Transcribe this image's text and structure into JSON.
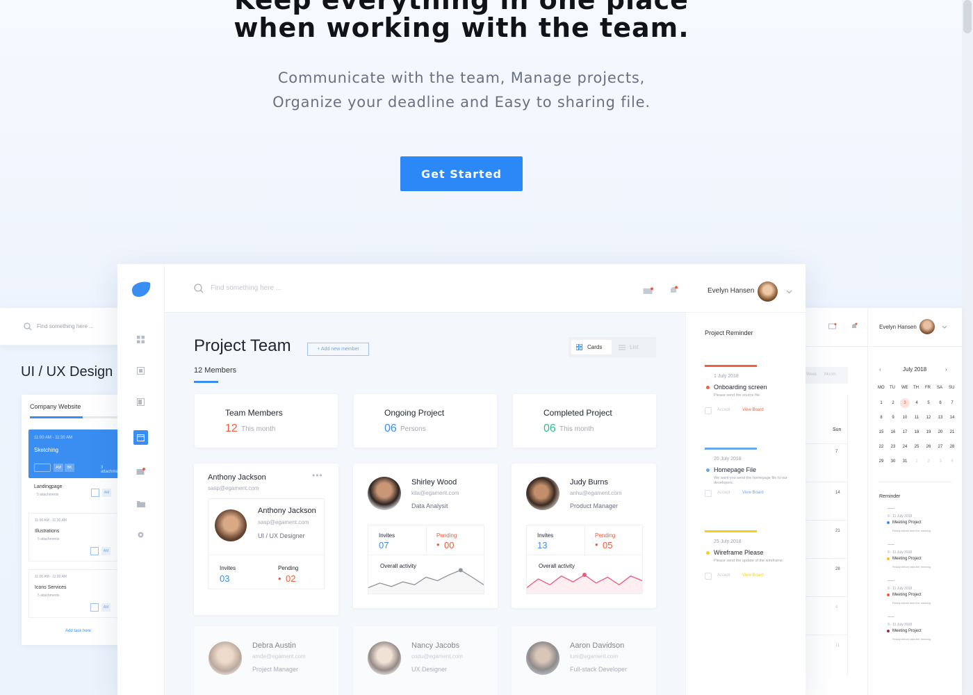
{
  "hero": {
    "title_partial": "Keep everything in one place",
    "title": "when working with the team.",
    "subtitle_line1": "Communicate with the team, Manage projects,",
    "subtitle_line2": "Organize your deadline and Easy to sharing file.",
    "cta": "Get Started"
  },
  "left_panel": {
    "search_placeholder": "Find something here ...",
    "heading": "UI / UX Design P",
    "project": "Company Website",
    "progress": 0.6,
    "tasks": [
      {
        "time": "11:00 AM - 11:30 AM",
        "title": "Sketching",
        "attachments": "3 attachments"
      },
      {
        "time": "",
        "title": "Landingpage",
        "attachments": "5 attachments"
      },
      {
        "time": "11:00 AM - 11:30 AM",
        "title": "Illustrations",
        "attachments": "5 attachments"
      },
      {
        "time": "11:00 AM - 11:30 AM",
        "title": "Icons Services",
        "attachments": "5 attachments"
      }
    ],
    "tag_am": "AM",
    "tag_bk": "BK",
    "add_task": "Add task here"
  },
  "right_panel": {
    "user": "Evelyn Hansen",
    "tabs": [
      "Week",
      "Month"
    ],
    "day_header": "Sun",
    "week_numbers": [
      "7",
      "14",
      "21",
      "28",
      "4",
      "11"
    ],
    "month": "July 2018",
    "weekdays": [
      "MO",
      "TU",
      "WE",
      "TH",
      "FR",
      "SA",
      "SU"
    ],
    "days": [
      "1",
      "2",
      "3",
      "4",
      "5",
      "6",
      "7",
      "8",
      "9",
      "10",
      "11",
      "12",
      "13",
      "14",
      "15",
      "16",
      "17",
      "18",
      "19",
      "20",
      "21",
      "22",
      "23",
      "24",
      "25",
      "26",
      "27",
      "28",
      "29",
      "30",
      "31",
      "1",
      "2",
      "3",
      "4"
    ],
    "reminder_title": "Reminder",
    "reminders": [
      {
        "date": "9 - 11 July 2018",
        "title": "Meeting Project",
        "note": "Ready before start the meeting",
        "color": "#3a8ef1"
      },
      {
        "date": "9 - 11 July 2018",
        "title": "Meeting Project",
        "note": "Ready before start the meeting",
        "color": "#f5c518"
      },
      {
        "date": "9 - 11 July 2018",
        "title": "Meeting Project",
        "note": "Ready before start the meeting",
        "color": "#f15a3a"
      },
      {
        "date": "9 - 11 July 2018",
        "title": "Meeting Project",
        "note": "Ready before start the meeting",
        "color": "#9b2f4a"
      }
    ]
  },
  "app": {
    "search_placeholder": "Find something here ...",
    "user": "Evelyn Hansen",
    "page_title": "Project Team",
    "add_member": "+ Add new member",
    "members_count": "12 Members",
    "view_cards": "Cards",
    "view_list": "List",
    "stats": [
      {
        "title": "Team Members",
        "value": "12",
        "note": "This month",
        "color": "#f15a3a"
      },
      {
        "title": "Ongoing Project",
        "value": "06",
        "note": "Persons",
        "color": "#3a8ef1"
      },
      {
        "title": "Completed Project",
        "value": "06",
        "note": "This month",
        "color": "#2fbd8e"
      }
    ],
    "featured": {
      "header_name": "Anthony Jackson",
      "header_email": "sasp@egament.com",
      "name": "Anthony Jackson",
      "email": "sasp@egament.com",
      "role": "UI / UX Designer",
      "invites_label": "Invites",
      "invites": "03",
      "pending_label": "Pending",
      "pending": "02"
    },
    "members": [
      {
        "name": "Shirley Wood",
        "email": "kila@egament.com",
        "role": "Data Analysit",
        "invites": "07",
        "pending": "00",
        "activity_label": "Overall activity",
        "activity": [
          40,
          48,
          42,
          50,
          45,
          58,
          52,
          62,
          70,
          58,
          45
        ]
      },
      {
        "name": "Judy Burns",
        "email": "anhu@egament.com",
        "role": "Product Manager",
        "invites": "13",
        "pending": "05",
        "activity_label": "Overall activity",
        "activity": [
          40,
          55,
          45,
          60,
          50,
          62,
          48,
          58,
          45,
          60,
          52
        ]
      }
    ],
    "invites_label": "Invites",
    "pending_label": "Pending",
    "faded_members": [
      {
        "name": "Debra Austin",
        "email": "amde@egament.com",
        "role": "Project Manager"
      },
      {
        "name": "Nancy Jacobs",
        "email": "codu@egament.com",
        "role": "UX Designer"
      },
      {
        "name": "Aaron Davidson",
        "email": "luni@egament.com",
        "role": "Full-stack Developer"
      }
    ],
    "reminder_title": "Project Reminder",
    "reminders": [
      {
        "date": "1 July 2018",
        "title": "Onboarding screen",
        "note": "Please send the source file.",
        "accept": "Accept",
        "view": "View Board",
        "color": "#f0603f"
      },
      {
        "date": "20 July 2018",
        "title": "Homepage File",
        "note": "We want you send the homepage file to our developers.",
        "accept": "Accept",
        "view": "View Board",
        "color": "#6aa6ec"
      },
      {
        "date": "25 July 2018",
        "title": "Wireframe Please",
        "note": "Please send the update of the wireframe.",
        "accept": "Accept",
        "view": "View Board",
        "color": "#f5cf1a"
      }
    ]
  }
}
